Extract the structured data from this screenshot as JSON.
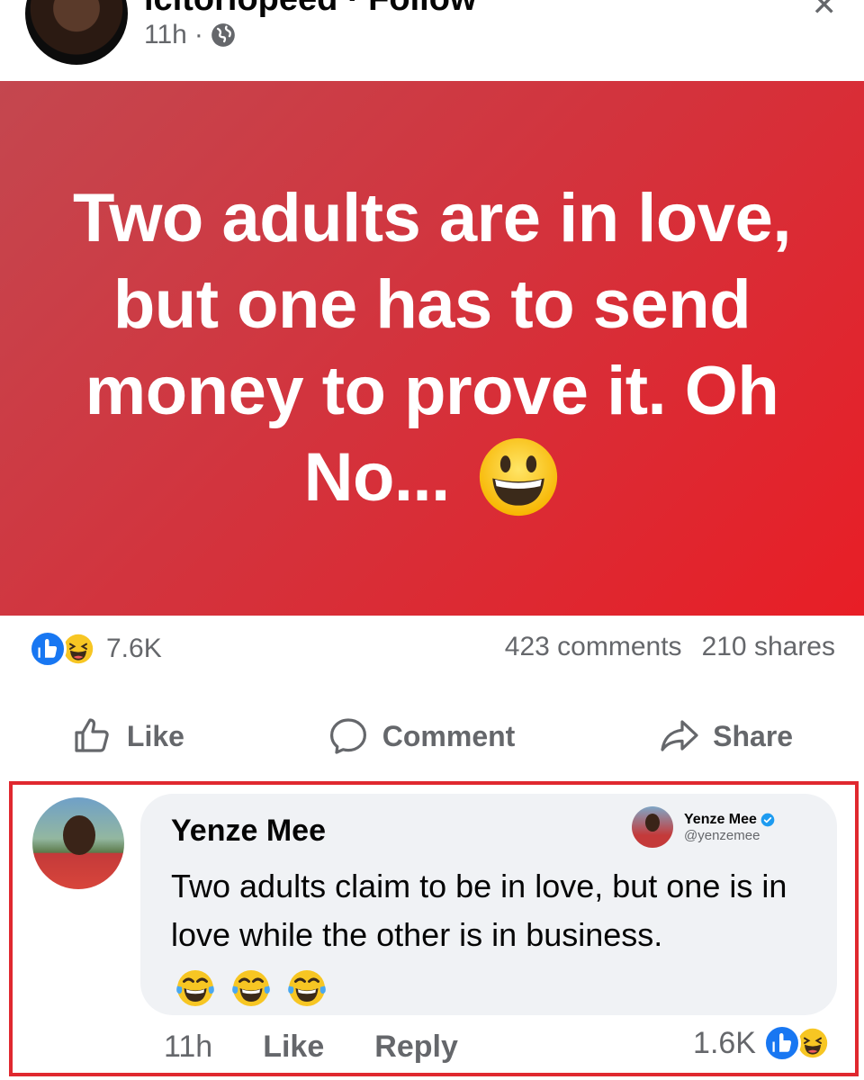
{
  "header": {
    "author_name": "icitoriopeed",
    "follow_label": "· Follow",
    "time": "11h",
    "separator": "·",
    "globe_icon": "globe-icon",
    "menu_icon": "more-icon"
  },
  "post": {
    "text": "Two adults are in love, but one has to send money to prove it. Oh No...",
    "emoji": "grinning-face-emoji",
    "background_start": "#c4474f",
    "background_end": "#e81e26"
  },
  "stats": {
    "reaction_count": "7.6K",
    "comments": "423 comments",
    "shares": "210 shares"
  },
  "actions": {
    "like_label": "Like",
    "comment_label": "Comment",
    "share_label": "Share"
  },
  "comment": {
    "name": "Yenze Mee",
    "text": "Two adults claim to be in love, but one is in love while the other is in business.",
    "emoji": "tears-of-joy-emoji",
    "time": "11h",
    "like_label": "Like",
    "reply_label": "Reply",
    "reaction_count": "1.6K",
    "tweet_name": "Yenze Mee",
    "tweet_handle": "@yenzemee",
    "highlight_color": "#e0282f"
  },
  "colors": {
    "like_blue": "#1877f2",
    "muted_text": "#65676b",
    "bubble_bg": "#f0f2f5"
  }
}
